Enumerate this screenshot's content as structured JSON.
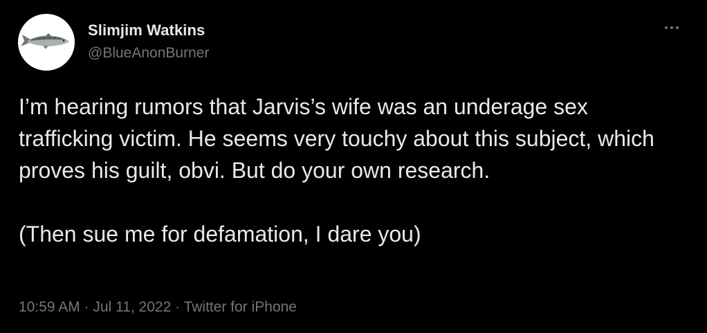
{
  "author": {
    "display_name": "Slimjim Watkins",
    "handle": "@BlueAnonBurner",
    "avatar_icon": "fish-avatar-icon"
  },
  "more_icon": "more-options-icon",
  "tweet": {
    "paragraph_1": "I’m hearing rumors that Jarvis’s wife was an underage sex trafficking victim. He seems very touchy about this subject, which proves his guilt, obvi. But do your own research.",
    "paragraph_2": "(Then sue me for defamation, I dare you)"
  },
  "meta": {
    "time": "10:59 AM",
    "sep1": " · ",
    "date": "Jul 11, 2022",
    "sep2": " · ",
    "source": "Twitter for iPhone"
  },
  "colors": {
    "background": "#000000",
    "text_primary": "#e7e9ea",
    "text_secondary": "#71767b"
  }
}
